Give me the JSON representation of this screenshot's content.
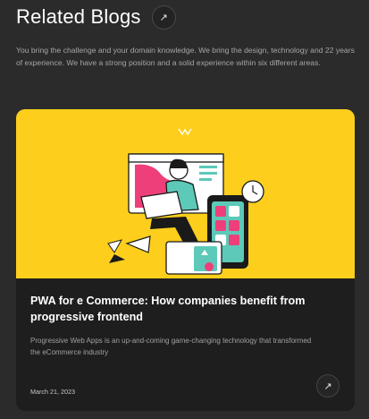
{
  "header": {
    "title": "Related Blogs",
    "arrow_icon": "↗"
  },
  "intro": {
    "text": "You bring the challenge and your domain knowledge. We bring the design, technology and 22 years of experience. We have a strong position and a solid experience within six different areas."
  },
  "card": {
    "title": "PWA for e Commerce: How companies benefit from progressive frontend",
    "description": "Progressive Web Apps is an up-and-coming game-changing technology that transformed the eCommerce industry",
    "date": "March 21, 2023",
    "arrow_icon": "↗",
    "image_background": "#fdcf1c",
    "accent_pink": "#ee3f7a",
    "accent_teal": "#5dc9b8"
  }
}
